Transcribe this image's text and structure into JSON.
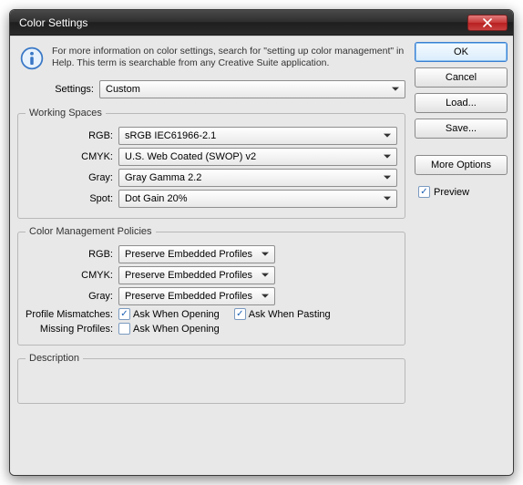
{
  "window": {
    "title": "Color Settings"
  },
  "info": {
    "text": "For more information on color settings, search for \"setting up color management\" in Help. This term is searchable from any Creative Suite application."
  },
  "settings": {
    "label": "Settings:",
    "value": "Custom"
  },
  "working_spaces": {
    "legend": "Working Spaces",
    "rgb_label": "RGB:",
    "rgb_value": "sRGB IEC61966-2.1",
    "cmyk_label": "CMYK:",
    "cmyk_value": "U.S. Web Coated (SWOP) v2",
    "gray_label": "Gray:",
    "gray_value": "Gray Gamma 2.2",
    "spot_label": "Spot:",
    "spot_value": "Dot Gain 20%"
  },
  "policies": {
    "legend": "Color Management Policies",
    "rgb_label": "RGB:",
    "rgb_value": "Preserve Embedded Profiles",
    "cmyk_label": "CMYK:",
    "cmyk_value": "Preserve Embedded Profiles",
    "gray_label": "Gray:",
    "gray_value": "Preserve Embedded Profiles",
    "mismatch_label": "Profile Mismatches:",
    "mismatch_opening": "Ask When Opening",
    "mismatch_pasting": "Ask When Pasting",
    "missing_label": "Missing Profiles:",
    "missing_opening": "Ask When Opening",
    "mismatch_opening_checked": true,
    "mismatch_pasting_checked": true,
    "missing_opening_checked": false
  },
  "description": {
    "legend": "Description"
  },
  "buttons": {
    "ok": "OK",
    "cancel": "Cancel",
    "load": "Load...",
    "save": "Save...",
    "more_options": "More Options"
  },
  "preview": {
    "label": "Preview",
    "checked": true
  }
}
